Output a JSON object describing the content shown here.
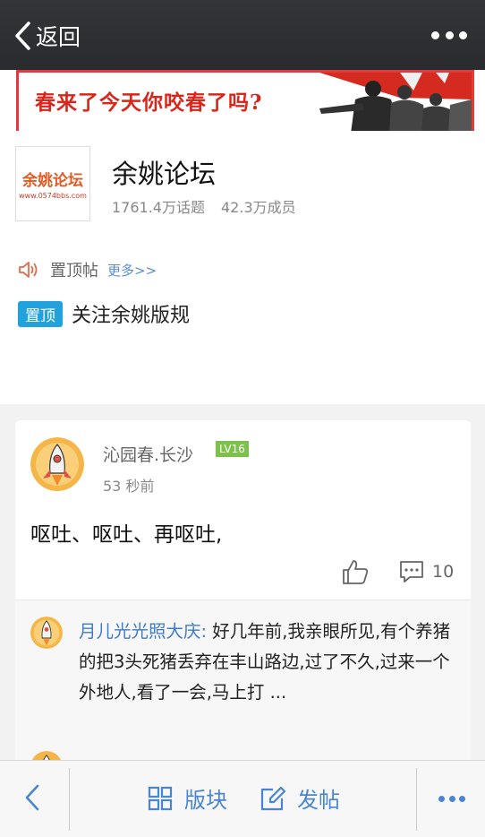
{
  "nav": {
    "back_label": "返回"
  },
  "banner": {
    "slogan": "春来了今天你咬春了吗?"
  },
  "forum": {
    "logo_text": "余姚论坛",
    "logo_url": "www.0574bbs.com",
    "name": "余姚论坛",
    "topics": "1761.4万话题",
    "members": "42.3万成员"
  },
  "pinned": {
    "heading": "置顶帖",
    "more": "更多>>",
    "badge": "置顶",
    "title": "关注余姚版规"
  },
  "post": {
    "author": "沁园春.长沙",
    "level": "LV16",
    "time": "53 秒前",
    "content": "呕吐、呕吐、再呕吐,",
    "comment_count": "10",
    "reply": {
      "name": "月儿光光照大庆:",
      "text": " 好几年前,我亲眼所见,有个养猪的把3头死猪丢弃在丰山路边,过了不久,过来一个外地人,看了一会,马上打 ..."
    }
  },
  "bottombar": {
    "board_label": "版块",
    "post_label": "发帖"
  },
  "colors": {
    "accent": "#4a86cf",
    "badge": "#22a2dc",
    "level": "#7cc24a",
    "nav_bg": "#2f3033",
    "banner_border": "#e23a3a"
  }
}
